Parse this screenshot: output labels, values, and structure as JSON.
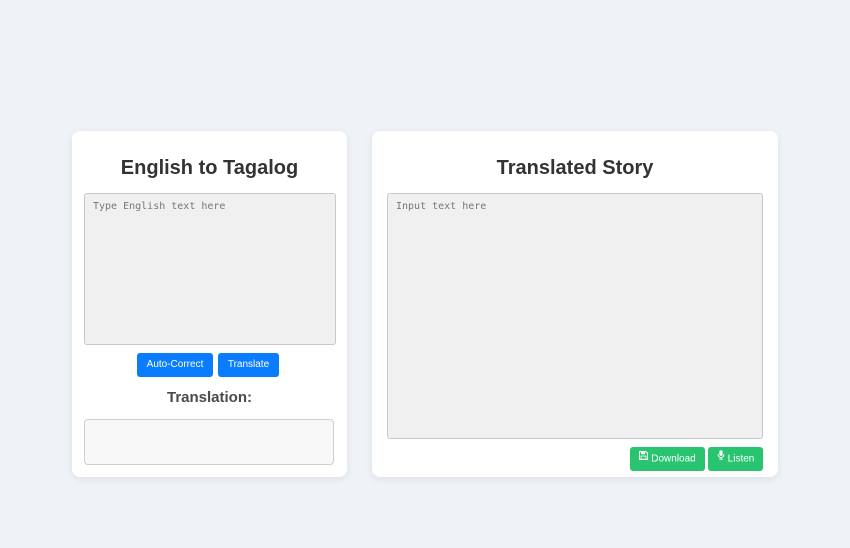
{
  "translator": {
    "title": "English to Tagalog",
    "input_placeholder": "Type English text here",
    "input_value": "",
    "autocorrect_label": "Auto-Correct",
    "translate_label": "Translate",
    "translation_heading": "Translation:",
    "translation_output": ""
  },
  "story": {
    "title": "Translated Story",
    "input_placeholder": "Input text here",
    "input_value": "",
    "download_label": "Download",
    "download_icon": "floppy-disk-icon",
    "listen_label": "Listen",
    "listen_icon": "microphone-icon"
  },
  "colors": {
    "page_background": "#eff2f7",
    "primary_blue": "#0a7cff",
    "success_green": "#28c46f"
  }
}
